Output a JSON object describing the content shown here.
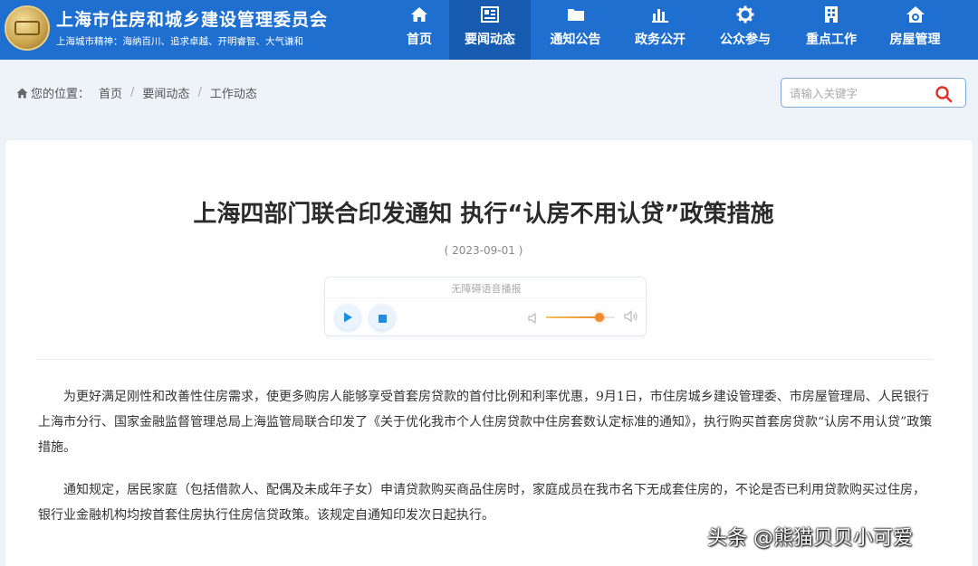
{
  "header": {
    "site_title": "上海市住房和城乡建设管理委员会",
    "slogan": "上海城市精神：海纳百川、追求卓越、开明睿智、大气谦和",
    "nav": [
      {
        "label": "首页",
        "icon": "home-icon"
      },
      {
        "label": "要闻动态",
        "icon": "news-icon",
        "active": true
      },
      {
        "label": "通知公告",
        "icon": "folder-icon"
      },
      {
        "label": "政务公开",
        "icon": "bar-chart-icon"
      },
      {
        "label": "公众参与",
        "icon": "gear-icon"
      },
      {
        "label": "重点工作",
        "icon": "building-icon"
      },
      {
        "label": "房屋管理",
        "icon": "house-gear-icon"
      }
    ]
  },
  "breadcrumb": {
    "prefix": "您的位置：",
    "items": [
      "首页",
      "要闻动态",
      "工作动态"
    ]
  },
  "search": {
    "placeholder": "请输入关键字"
  },
  "article": {
    "title": "上海四部门联合印发通知 执行“认房不用认贷”政策措施",
    "date": "( 2023-09-01 )",
    "audio_label": "无障碍语音播报",
    "volume_level": 0.78,
    "paragraphs": [
      "为更好满足刚性和改善性住房需求，使更多购房人能够享受首套房贷款的首付比例和利率优惠，9月1日，市住房城乡建设管理委、市房屋管理局、人民银行上海市分行、国家金融监督管理总局上海监管局联合印发了《关于优化我市个人住房贷款中住房套数认定标准的通知》，执行购买首套房贷款“认房不用认贷”政策措施。",
      "通知规定，居民家庭（包括借款人、配偶及未成年子女）申请贷款购买商品住房时，家庭成员在我市名下无成套住房的，不论是否已利用贷款购买过住房，银行业金融机构均按首套住房执行住房信贷政策。该规定自通知印发次日起执行。"
    ]
  },
  "watermark": "头条 @熊猫贝贝小可爱",
  "colors": {
    "header_bg": "#1e6fd0",
    "nav_active_bg": "#175cb1",
    "search_icon": "#e0322b",
    "accent_orange": "#f08a2c"
  }
}
